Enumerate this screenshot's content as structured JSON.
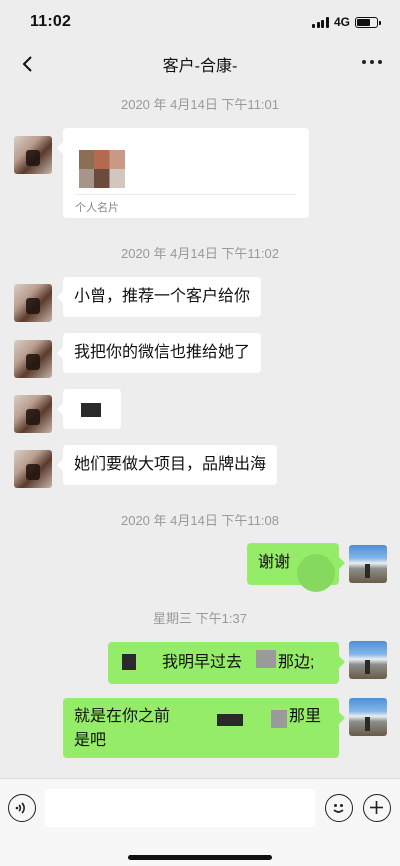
{
  "status_bar": {
    "time": "11:02",
    "network": "4G",
    "battery_level_percent": 70
  },
  "nav": {
    "title": "客户-合康-",
    "back_icon": "chevron-left-icon",
    "more_icon": "more-dots-icon"
  },
  "messages": {
    "ts1": "2020 年 4月14日 下午11:01",
    "card_label": "个人名片",
    "ts2": "2020 年 4月14日 下午11:02",
    "m1": "小曾，推荐一个客户给你",
    "m2": "我把你的微信也推给她了",
    "m4": "她们要做大项目，品牌出海",
    "ts3": "2020 年 4月14日 下午11:08",
    "m5": "谢谢",
    "ts4": "星期三 下午1:37",
    "m6_a": "我明早过去",
    "m6_b": "那边;",
    "m7_a": "就是在你之前",
    "m7_b": "那里",
    "m7_c": "是吧"
  },
  "input_bar": {
    "voice_icon": "voice-icon",
    "emoji_icon": "emoji-icon",
    "plus_icon": "plus-icon"
  }
}
